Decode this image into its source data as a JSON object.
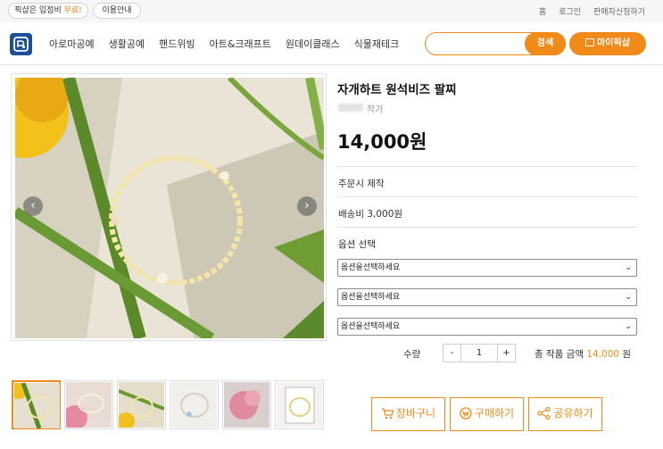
{
  "topbar": {
    "free_entry_prefix": "픽샵은 입점비 ",
    "free_entry_highlight": "무료!",
    "guide_label": "이용안내",
    "links": [
      "홈",
      "로그인",
      "판매자신청하기"
    ]
  },
  "header": {
    "logo_icon": "pickshop-logo-icon",
    "nav": [
      "아로마공예",
      "생활공예",
      "핸드위빙",
      "아트&크래프트",
      "원데이클래스",
      "식물재테크"
    ],
    "search": {
      "value": "",
      "placeholder": "",
      "button_label": "검색"
    },
    "mypage_label": "마이픽샵",
    "accent_color": "#f28a19"
  },
  "product": {
    "title": "자개하트 원석비즈 팔찌",
    "artist_suffix": "작가",
    "price": "14,000원",
    "made_to_order": "주문시 제작",
    "shipping": "배송비 3,000원",
    "option_label": "옵션 선택",
    "options": [
      {
        "selected": "옵션을선택하세요"
      },
      {
        "selected": "옵션을선택하세요"
      },
      {
        "selected": "옵션을선택하세요"
      }
    ],
    "quantity_label": "수량",
    "quantity_minus": "-",
    "quantity_value": "1",
    "quantity_plus": "+",
    "total_prefix": "총 작품 금액",
    "total_amount": "14,000",
    "total_unit": "원"
  },
  "gallery": {
    "prev_icon": "chevron-left-icon",
    "next_icon": "chevron-right-icon",
    "prev_glyph": "‹",
    "next_glyph": "›",
    "thumbnail_count": 6
  },
  "actions": {
    "cart_label": "장바구니",
    "buy_label": "구매하기",
    "share_label": "공유하기",
    "cart_icon": "cart-icon",
    "buy_icon": "won-coin-icon",
    "share_icon": "share-icon"
  }
}
